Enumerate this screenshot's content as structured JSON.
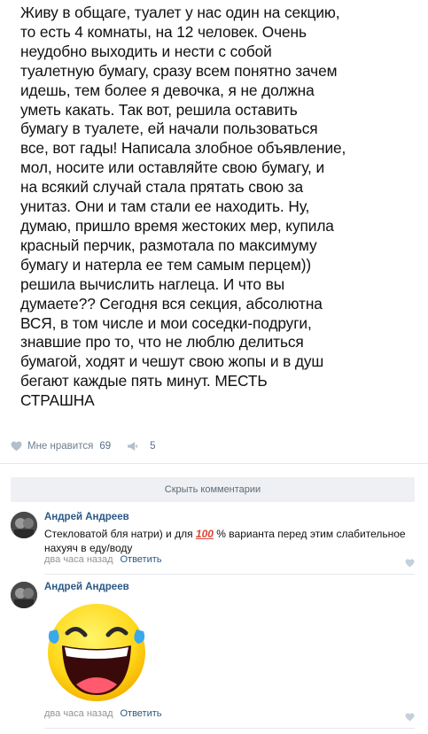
{
  "post": {
    "lines": [
      "Живу в общаге, туалет у нас один на секцию,",
      "то есть 4 комнаты, на 12 человек. Очень",
      "неудобно выходить и нести с собой",
      "туалетную бумагу, сразу всем понятно зачем",
      "идешь, тем более я девочка, я не должна",
      "уметь какать. Так вот, решила оставить",
      "бумагу в туалете, ей начали пользоваться",
      "все, вот гады! Написала злобное объявление,",
      "мол, носите или оставляйте свою бумагу, и",
      "на всякий случай стала прятать свою за",
      "унитаз. Они и там стали ее находить. Ну,",
      "думаю, пришло время жестоких мер, купила",
      "красный перчик, размотала по максимуму",
      "бумагу и натерла ее тем самым перцем))",
      "решила вычислить наглеца. И что вы",
      "думаете?? Сегодня вся секция, абсолютна",
      "ВСЯ, в том числе и мои соседки-подруги,",
      "знавшие про то, что не люблю делиться",
      "бумагой, ходят и чешут свою жопы и в душ",
      "бегают каждые пять минут. МЕСТЬ",
      "СТРАШНА"
    ],
    "likes_label": "Мне нравится",
    "likes_count": "69",
    "shares_count": "5"
  },
  "hide_comments_label": "Скрыть комментарии",
  "comments": [
    {
      "author": "Андрей Андреев",
      "text_before": "Стекловатой бля натри) и для ",
      "emoji": "100",
      "text_after": " % варианта перед этим слабительное",
      "text_line2": "нахуяч в еду/воду",
      "time": "два часа назад",
      "reply": "Ответить"
    },
    {
      "author": "Андрей Андреев",
      "sticker": "laughing-emoji-sticker",
      "time": "два часа назад",
      "reply": "Ответить"
    }
  ],
  "colors": {
    "link": "#2a5885",
    "meta": "#939393",
    "button_bg": "#eef0f3"
  }
}
